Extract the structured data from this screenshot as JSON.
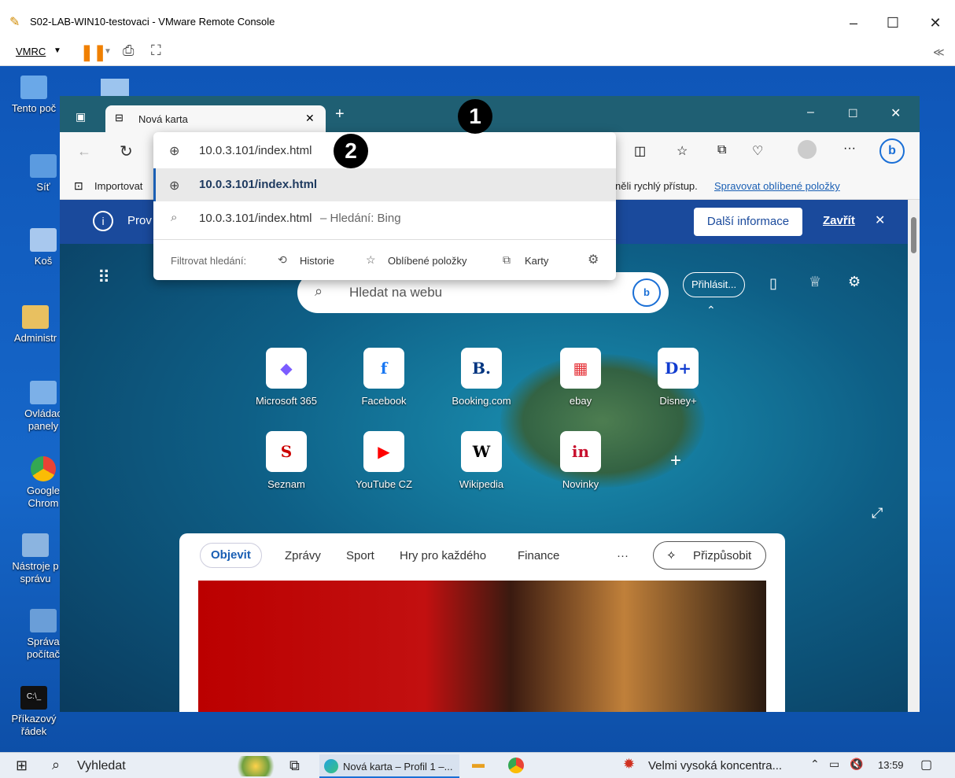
{
  "vmrc": {
    "window_title": "S02-LAB-WIN10-testovaci - VMware Remote Console",
    "menu_label": "VMRC",
    "collapse_glyph": "≪"
  },
  "desktop_icons": [
    {
      "label": "Tento poč"
    },
    {
      "label": "Síť"
    },
    {
      "label": "Koš"
    },
    {
      "label": "Administr"
    },
    {
      "label": "Ovládac panely"
    },
    {
      "label": "Google Chrom"
    },
    {
      "label": "Nástroje p správu"
    },
    {
      "label": "Správa počítač"
    },
    {
      "label": "Příkazový řádek"
    }
  ],
  "browser": {
    "tab_title": "Nová karta",
    "address_value": "10.0.3.101/index.html",
    "favorites_import": "Importovat",
    "favorites_hint": "něli rychlý přístup.",
    "favorites_link": "Spravovat oblíbené položky",
    "infobar_text": "Prov",
    "infobar_button": "Další informace",
    "infobar_close": "Zavřít",
    "omnibox": {
      "suggestion_url": "10.0.3.101/index.html",
      "search_query": "10.0.3.101/index.html",
      "search_suffix": " – Hledání: Bing",
      "filter_label": "Filtrovat hledání:",
      "filter_history": "Historie",
      "filter_favorites": "Oblíbené položky",
      "filter_tabs": "Karty"
    },
    "ntp": {
      "search_placeholder": "Hledat na webu",
      "signin": "Přihlásit...",
      "tiles": [
        {
          "label": "Microsoft 365",
          "glyph": "◆",
          "color": "#7b5cff"
        },
        {
          "label": "Facebook",
          "glyph": "f",
          "color": "#1877f2"
        },
        {
          "label": "Booking.com",
          "glyph": "B.",
          "color": "#003580"
        },
        {
          "label": "ebay",
          "glyph": "▦",
          "color": "#e53238"
        },
        {
          "label": "Disney+",
          "glyph": "D+",
          "color": "#113ccf"
        },
        {
          "label": "Seznam",
          "glyph": "S",
          "color": "#cc0000"
        },
        {
          "label": "YouTube CZ",
          "glyph": "▶",
          "color": "#ff0000"
        },
        {
          "label": "Wikipedia",
          "glyph": "W",
          "color": "#000000"
        },
        {
          "label": "Novinky",
          "glyph": "in",
          "color": "#c8102e"
        }
      ],
      "feed_tabs": [
        "Objevit",
        "Zprávy",
        "Sport",
        "Hry pro každého",
        "Finance"
      ],
      "feed_more": "···",
      "customize": "Přizpůsobit"
    }
  },
  "callouts": {
    "one": "1",
    "two": "2"
  },
  "taskbar": {
    "search_label": "Vyhledat",
    "edge_label": "Nová karta – Profil 1 –...",
    "notification_text": "Velmi vysoká koncentra...",
    "clock": "13:59"
  }
}
